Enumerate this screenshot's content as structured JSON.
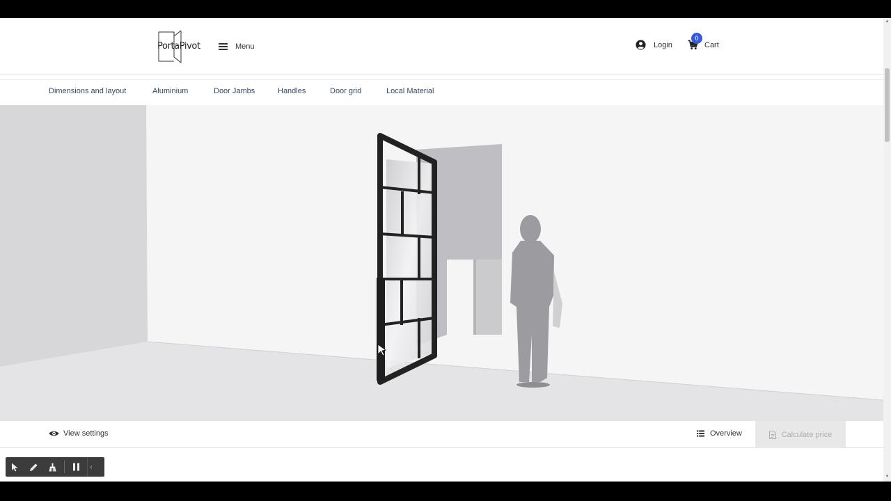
{
  "brand": {
    "logo_text": "PortaPivot"
  },
  "header": {
    "menu_label": "Menu",
    "login_label": "Login",
    "cart_label": "Cart",
    "cart_count": "0"
  },
  "tabs": [
    {
      "label": "Dimensions and layout"
    },
    {
      "label": "Aluminium"
    },
    {
      "label": "Door Jambs"
    },
    {
      "label": "Handles"
    },
    {
      "label": "Door grid"
    },
    {
      "label": "Local Material"
    }
  ],
  "footer": {
    "view_settings_label": "View settings",
    "overview_label": "Overview",
    "calculate_label": "Calculate price"
  },
  "icons": {
    "menu": "hamburger-icon",
    "login": "user-circle-icon",
    "cart": "shopping-cart-icon",
    "view_settings": "eye-icon",
    "overview": "list-icon",
    "calculate": "document-icon",
    "tools": [
      "pointer-icon",
      "pencil-icon",
      "broom-icon",
      "pause-icon",
      "chevron-left-icon"
    ]
  },
  "colors": {
    "accent": "#3b5bd6",
    "tab_text": "#35495e",
    "door_frame": "#222222",
    "disabled_button": "#e8e8e8"
  }
}
